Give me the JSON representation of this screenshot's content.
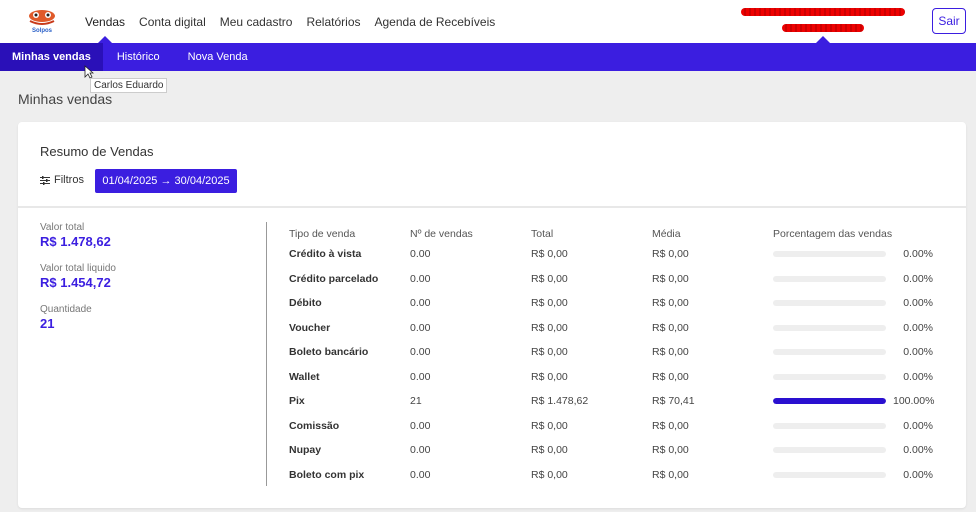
{
  "brand": {
    "logo_text": "Solpos",
    "accent": "#3b1ee0"
  },
  "top_nav": [
    {
      "label": "Vendas",
      "active": true
    },
    {
      "label": "Conta digital",
      "active": false
    },
    {
      "label": "Meu cadastro",
      "active": false
    },
    {
      "label": "Relatórios",
      "active": false
    },
    {
      "label": "Agenda de Recebíveis",
      "active": false
    }
  ],
  "header": {
    "logout_label": "Sair"
  },
  "sub_nav": [
    {
      "label": "Minhas vendas",
      "active": true
    },
    {
      "label": "Histórico",
      "active": false
    },
    {
      "label": "Nova Venda",
      "active": false
    }
  ],
  "tooltip": "Carlos Eduardo",
  "page_title": "Minhas vendas",
  "card": {
    "title": "Resumo de Vendas",
    "filter_label": "Filtros",
    "date_range": "01/04/2025 → 30/04/2025"
  },
  "summary": {
    "total_label": "Valor total",
    "total_value": "R$ 1.478,62",
    "net_label": "Valor total liquido",
    "net_value": "R$ 1.454,72",
    "qty_label": "Quantidade",
    "qty_value": "21"
  },
  "table": {
    "headers": [
      "Tipo de venda",
      "Nº de vendas",
      "Total",
      "Média",
      "Porcentagem das vendas"
    ],
    "rows": [
      {
        "type": "Crédito à vista",
        "count": "0.00",
        "total": "R$ 0,00",
        "avg": "R$ 0,00",
        "pct_label": "0.00%",
        "pct": 0
      },
      {
        "type": "Crédito parcelado",
        "count": "0.00",
        "total": "R$ 0,00",
        "avg": "R$ 0,00",
        "pct_label": "0.00%",
        "pct": 0
      },
      {
        "type": "Débito",
        "count": "0.00",
        "total": "R$ 0,00",
        "avg": "R$ 0,00",
        "pct_label": "0.00%",
        "pct": 0
      },
      {
        "type": "Voucher",
        "count": "0.00",
        "total": "R$ 0,00",
        "avg": "R$ 0,00",
        "pct_label": "0.00%",
        "pct": 0
      },
      {
        "type": "Boleto bancário",
        "count": "0.00",
        "total": "R$ 0,00",
        "avg": "R$ 0,00",
        "pct_label": "0.00%",
        "pct": 0
      },
      {
        "type": "Wallet",
        "count": "0.00",
        "total": "R$ 0,00",
        "avg": "R$ 0,00",
        "pct_label": "0.00%",
        "pct": 0
      },
      {
        "type": "Pix",
        "count": "21",
        "total": "R$ 1.478,62",
        "avg": "R$ 70,41",
        "pct_label": "100.00%",
        "pct": 100
      },
      {
        "type": "Comissão",
        "count": "0.00",
        "total": "R$ 0,00",
        "avg": "R$ 0,00",
        "pct_label": "0.00%",
        "pct": 0
      },
      {
        "type": "Nupay",
        "count": "0.00",
        "total": "R$ 0,00",
        "avg": "R$ 0,00",
        "pct_label": "0.00%",
        "pct": 0
      },
      {
        "type": "Boleto com pix",
        "count": "0.00",
        "total": "R$ 0,00",
        "avg": "R$ 0,00",
        "pct_label": "0.00%",
        "pct": 0
      }
    ]
  }
}
